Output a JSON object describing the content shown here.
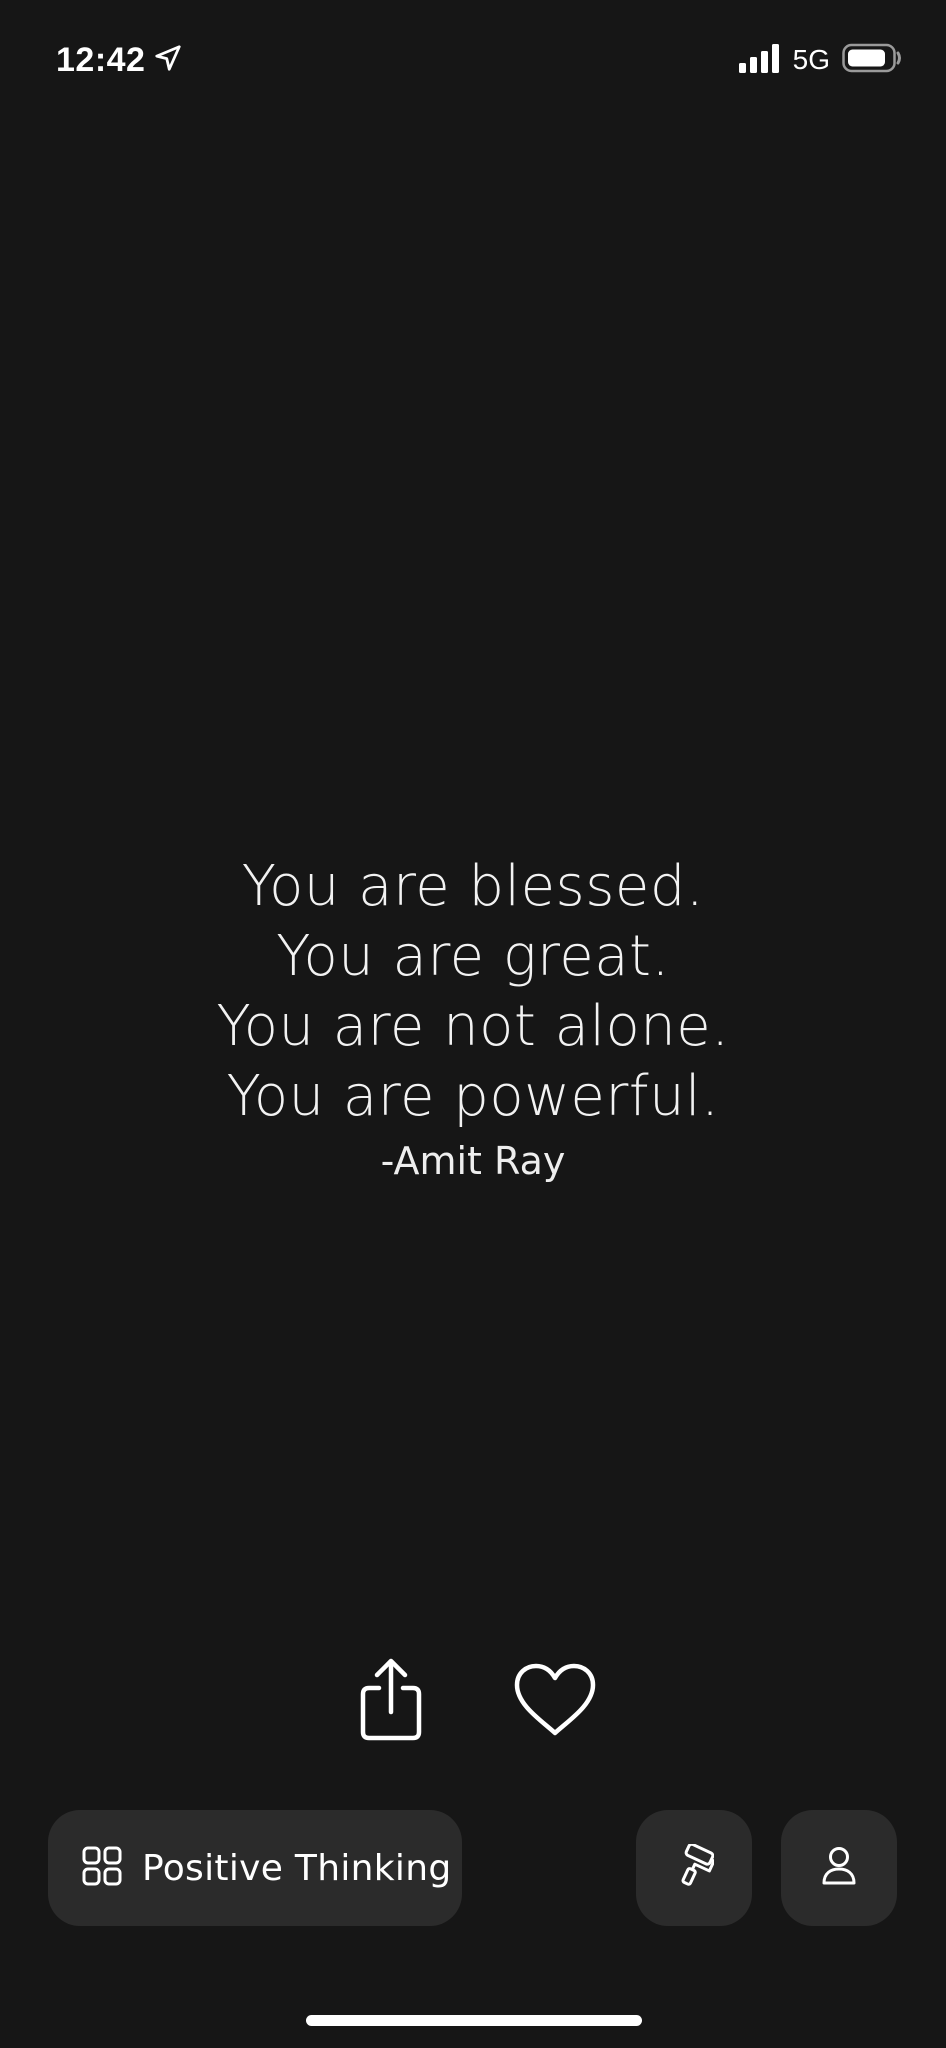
{
  "status_bar": {
    "time": "12:42",
    "network": "5G",
    "location_icon": "location-arrow-icon",
    "signal_icon": "signal-bars-icon",
    "battery_icon": "battery-icon"
  },
  "quote": {
    "lines": [
      "You are blessed.",
      "You are great.",
      "You are not alone.",
      "You are powerful."
    ],
    "author": "-Amit Ray"
  },
  "actions": {
    "share_icon": "share-icon",
    "favorite_icon": "heart-icon"
  },
  "bottom_bar": {
    "category_label": "Positive Thinking",
    "category_icon": "grid-icon",
    "theme_icon": "paint-roller-icon",
    "profile_icon": "person-icon"
  },
  "colors": {
    "background": "#161616",
    "button_background": "#2b2b2b",
    "foreground": "#ffffff"
  }
}
